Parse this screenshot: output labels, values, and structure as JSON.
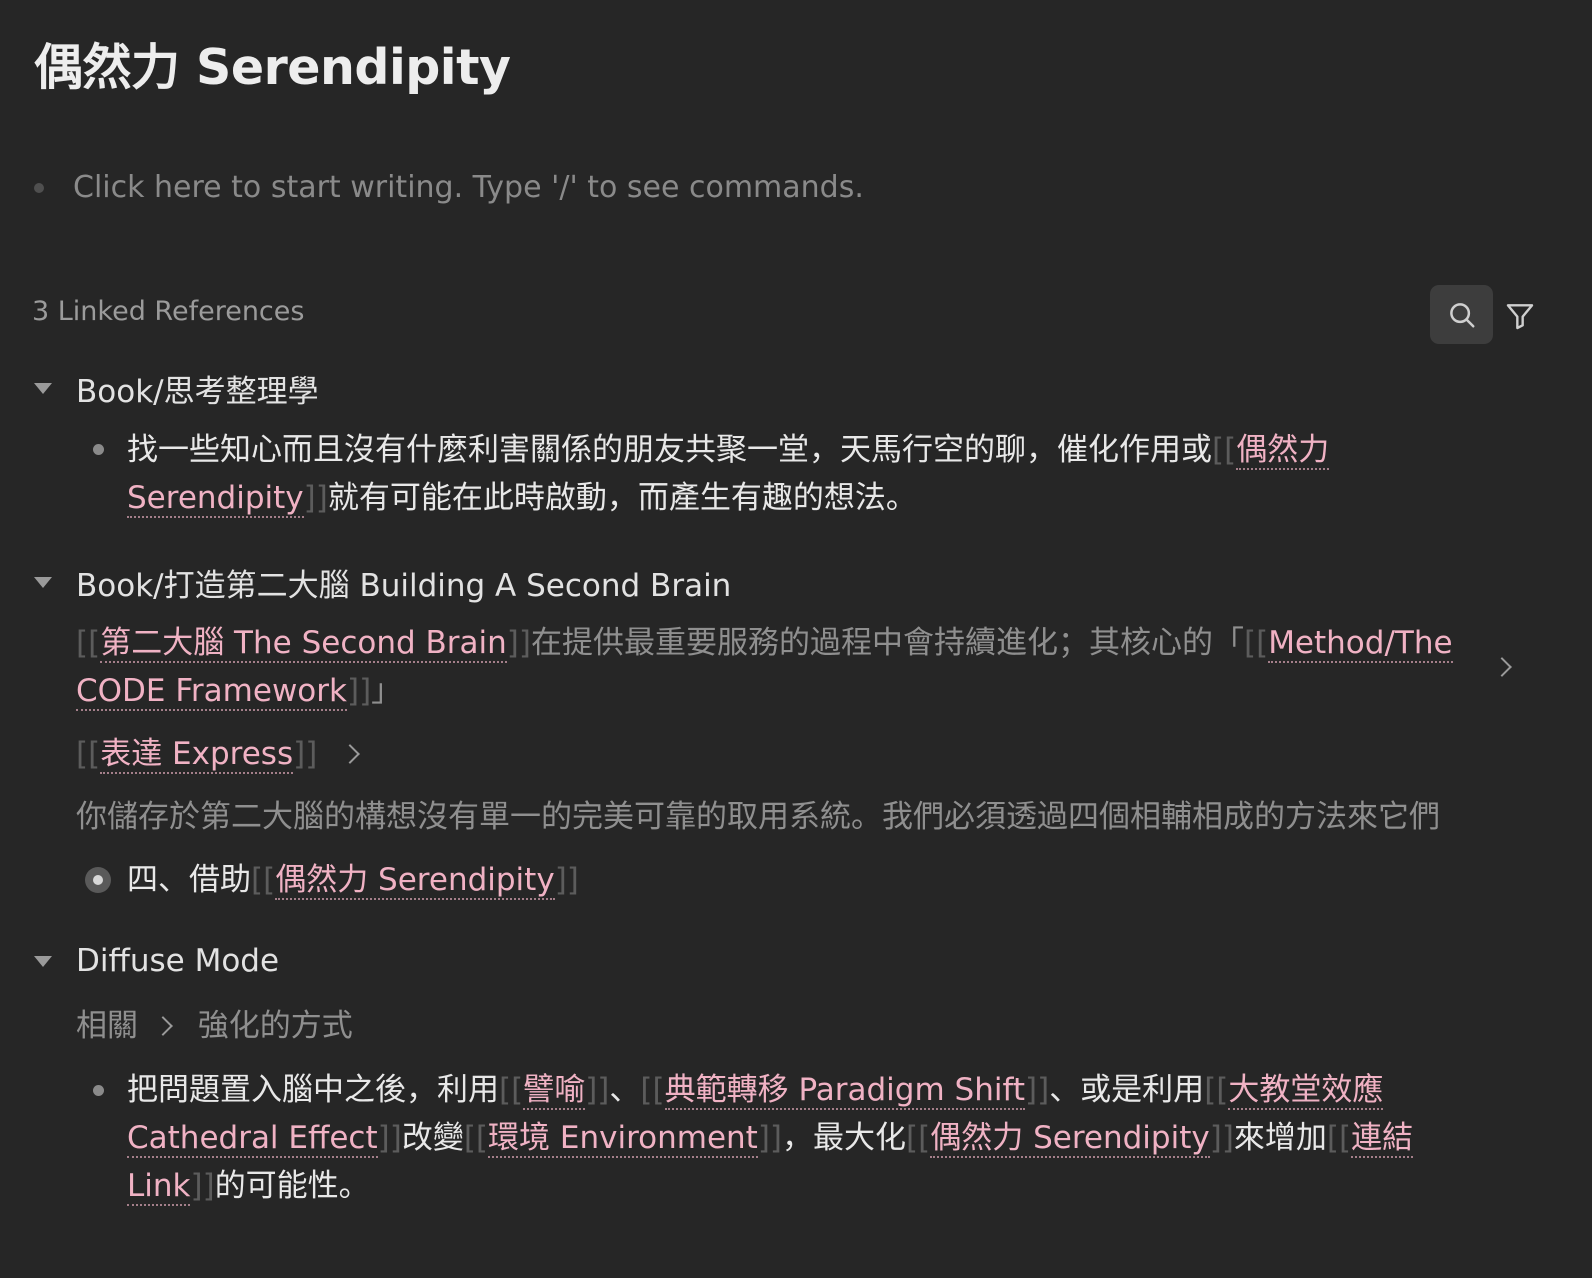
{
  "page": {
    "title": "偶然力 Serendipity"
  },
  "editor": {
    "placeholder": "Click here to start writing. Type '/' to see commands."
  },
  "linked_refs": {
    "header": "3 Linked References",
    "icons": {
      "search": "search-icon",
      "filter": "filter-icon"
    },
    "groups": [
      {
        "title": "Book/思考整理學",
        "block": {
          "t1": "找一些知心而且沒有什麼利害關係的朋友共聚一堂，天馬行空的聊，催化作用或",
          "link1": "偶然力 Serendipity",
          "t2": "就有可能在此時啟動，而產生有趣的想法。"
        }
      },
      {
        "title": "Book/打造第二大腦 Building A Second Brain",
        "crumb1": {
          "link1": "第二大腦 The Second Brain",
          "t1": "在提供最重要服務的過程中會持續進化；其核心的「",
          "link2": "Method/The CODE Framework",
          "t2": "」"
        },
        "crumb2": {
          "link1": "表達 Express"
        },
        "crumb3": {
          "text": "你儲存於第二大腦的構想沒有單一的完美可靠的取用系統。我們必須透過四個相輔相成的方法來它們"
        },
        "block": {
          "t1": "四、借助",
          "link1": "偶然力 Serendipity"
        }
      },
      {
        "title": "Diffuse Mode",
        "crumb": {
          "item1": "相關",
          "item2": "強化的方式"
        },
        "block": {
          "t1": "把問題置入腦中之後，利用",
          "link1": "譬喻",
          "t2": "、",
          "link2": "典範轉移 Paradigm Shift",
          "t3": "、或是利用",
          "link3": "大教堂效應 Cathedral Effect",
          "t4": "改變",
          "link4": "環境 Environment",
          "t5": "，最大化",
          "link5": "偶然力 Serendipity",
          "t6": "來增加",
          "link6": "連結 Link",
          "t7": "的可能性。"
        }
      }
    ]
  },
  "colors": {
    "background": "#262626",
    "link": "#f0b2c4",
    "muted": "#8f8f8f"
  }
}
